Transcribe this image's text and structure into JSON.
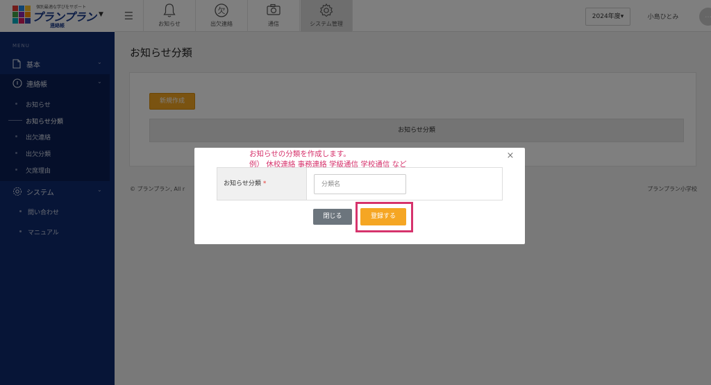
{
  "brand": {
    "tagline": "個別最適な学びをサポート",
    "name": "プランプラン",
    "subtitle": "連絡帳",
    "mosaic_colors": [
      "#e53935",
      "#1e88e5",
      "#fbc02d",
      "#43a047",
      "#8e24aa",
      "#fb8c00",
      "#00acc1",
      "#d81b60",
      "#3949ab"
    ]
  },
  "nav": {
    "tabs": [
      {
        "label": "お知らせ",
        "icon": "bell-icon"
      },
      {
        "label": "出欠連絡",
        "icon": "absence-icon",
        "glyph": "欠"
      },
      {
        "label": "通信",
        "icon": "camera-icon"
      },
      {
        "label": "システム管理",
        "icon": "gear-icon"
      }
    ]
  },
  "header": {
    "year": "2024年度",
    "user": "小島ひとみ"
  },
  "sidebar": {
    "caption": "MENU",
    "basic": "基本",
    "contact": "連絡帳",
    "contact_items": [
      {
        "label": "お知らせ"
      },
      {
        "label": "お知らせ分類"
      },
      {
        "label": "出欠連絡"
      },
      {
        "label": "出欠分類"
      },
      {
        "label": "欠席理由"
      }
    ],
    "system": "システム",
    "system_items": [
      {
        "label": "問い合わせ"
      },
      {
        "label": "マニュアル"
      }
    ]
  },
  "main": {
    "title": "お知らせ分類",
    "new_button": "新規作成",
    "table_header": "お知らせ分類",
    "footer_left": "© プランプラン, All r",
    "footer_right": "プランプラン小学校"
  },
  "modal": {
    "annotation_line1": "お知らせの分類を作成します。",
    "annotation_line2": "例） 休校連絡 事務連絡 学級通信 学校通信 など",
    "close_glyph": "×",
    "field_label": "お知らせ分類",
    "required_mark": "*",
    "input_placeholder": "分類名",
    "input_value": "",
    "close_button": "閉じる",
    "submit_button": "登録する",
    "highlight_color": "#d6336c"
  }
}
